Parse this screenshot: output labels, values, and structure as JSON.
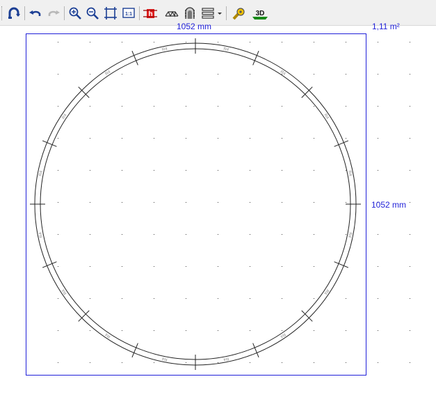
{
  "toolbar": {
    "tools": [
      {
        "name": "undo-history-icon"
      },
      {
        "name": "undo-icon"
      },
      {
        "name": "redo-icon"
      },
      {
        "name": "zoom-in-icon"
      },
      {
        "name": "zoom-out-icon"
      },
      {
        "name": "fit-to-window-icon"
      },
      {
        "name": "zoom-1-1-icon",
        "label": "1:1"
      },
      {
        "name": "height-marker-icon",
        "label": "h"
      },
      {
        "name": "bridge-icon"
      },
      {
        "name": "tunnel-icon"
      },
      {
        "name": "layers-icon"
      },
      {
        "name": "dropdown-arrow-icon"
      },
      {
        "name": "measure-tape-icon"
      },
      {
        "name": "view-3d-icon",
        "label": "3D"
      }
    ]
  },
  "layout_info": {
    "width_label": "1052 mm",
    "height_label": "1052 mm",
    "area_label": "1,11 m²"
  },
  "track": {
    "segment_label": "R4",
    "segment_count": 16,
    "shape": "circle"
  },
  "colors": {
    "dimension": "#1f1fd8",
    "frame": "#1f1fd8",
    "track": "#222222",
    "label": "#8a8a8a",
    "grid_dot": "#444444",
    "toolbar_bg": "#f0f0f0"
  }
}
